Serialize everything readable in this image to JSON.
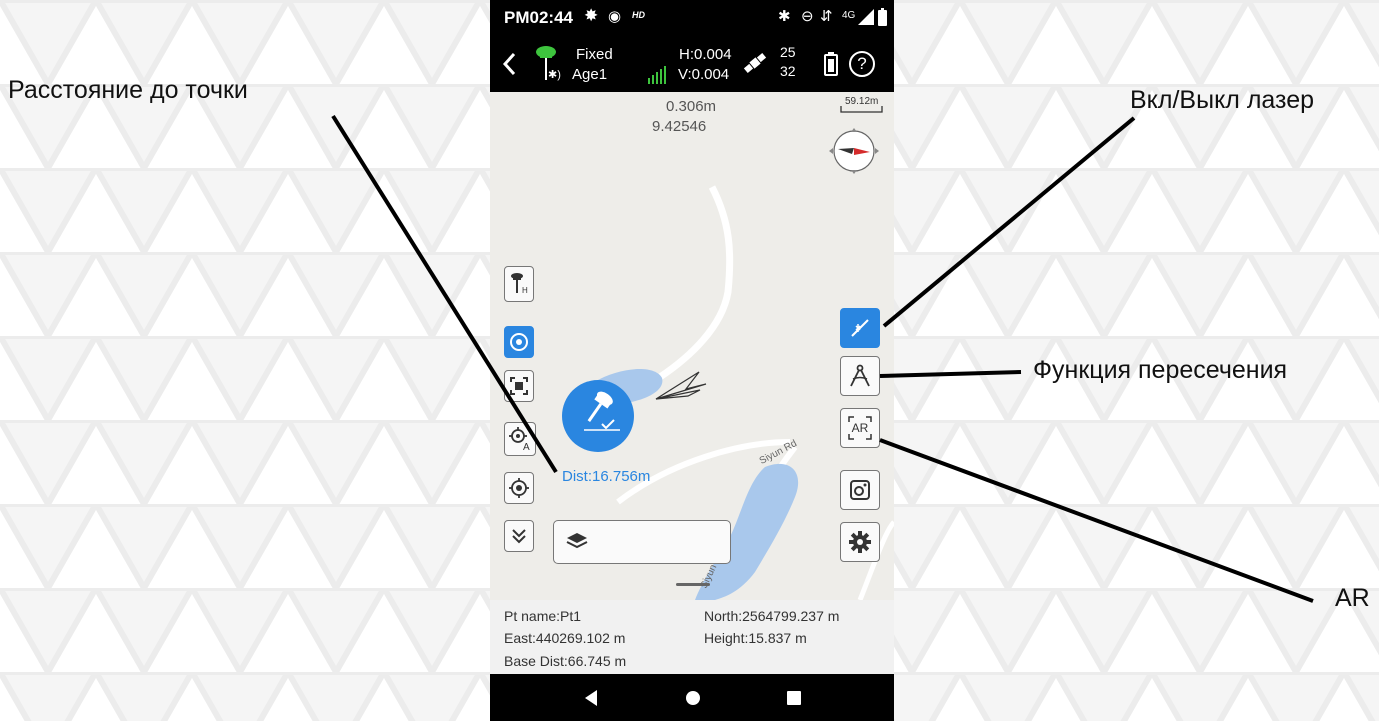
{
  "annotations": {
    "distance": "Расстояние до точки",
    "laser": "Вкл/Выкл лазер",
    "intersection": "Функция пересечения",
    "ar": "AR"
  },
  "status_bar": {
    "time": "PM02:44",
    "hd": "HD",
    "network": "4G"
  },
  "top_bar": {
    "fix_status": "Fixed",
    "age": "Age1",
    "h_precision": "H:0.004",
    "v_precision": "V:0.004",
    "sats_used": "25",
    "sats_visible": "32",
    "help": "?"
  },
  "map": {
    "scale": "59.12m",
    "distance_offset": "0.306m",
    "bearing": "9.42546",
    "road_label_1": "Siyun Rd",
    "road_label_2": "Siyun Rd",
    "dist_label": "Dist:16.756m"
  },
  "buttons": {
    "ar_label": "AR"
  },
  "info": {
    "pt_name": "Pt name:Pt1",
    "north": "North:2564799.237 m",
    "east": "East:440269.102 m",
    "height": "Height:15.837 m",
    "base_dist": "Base Dist:66.745 m"
  },
  "colors": {
    "accent": "#2a86e0",
    "water": "#a9c8ec",
    "signal": "#3ec43e"
  }
}
